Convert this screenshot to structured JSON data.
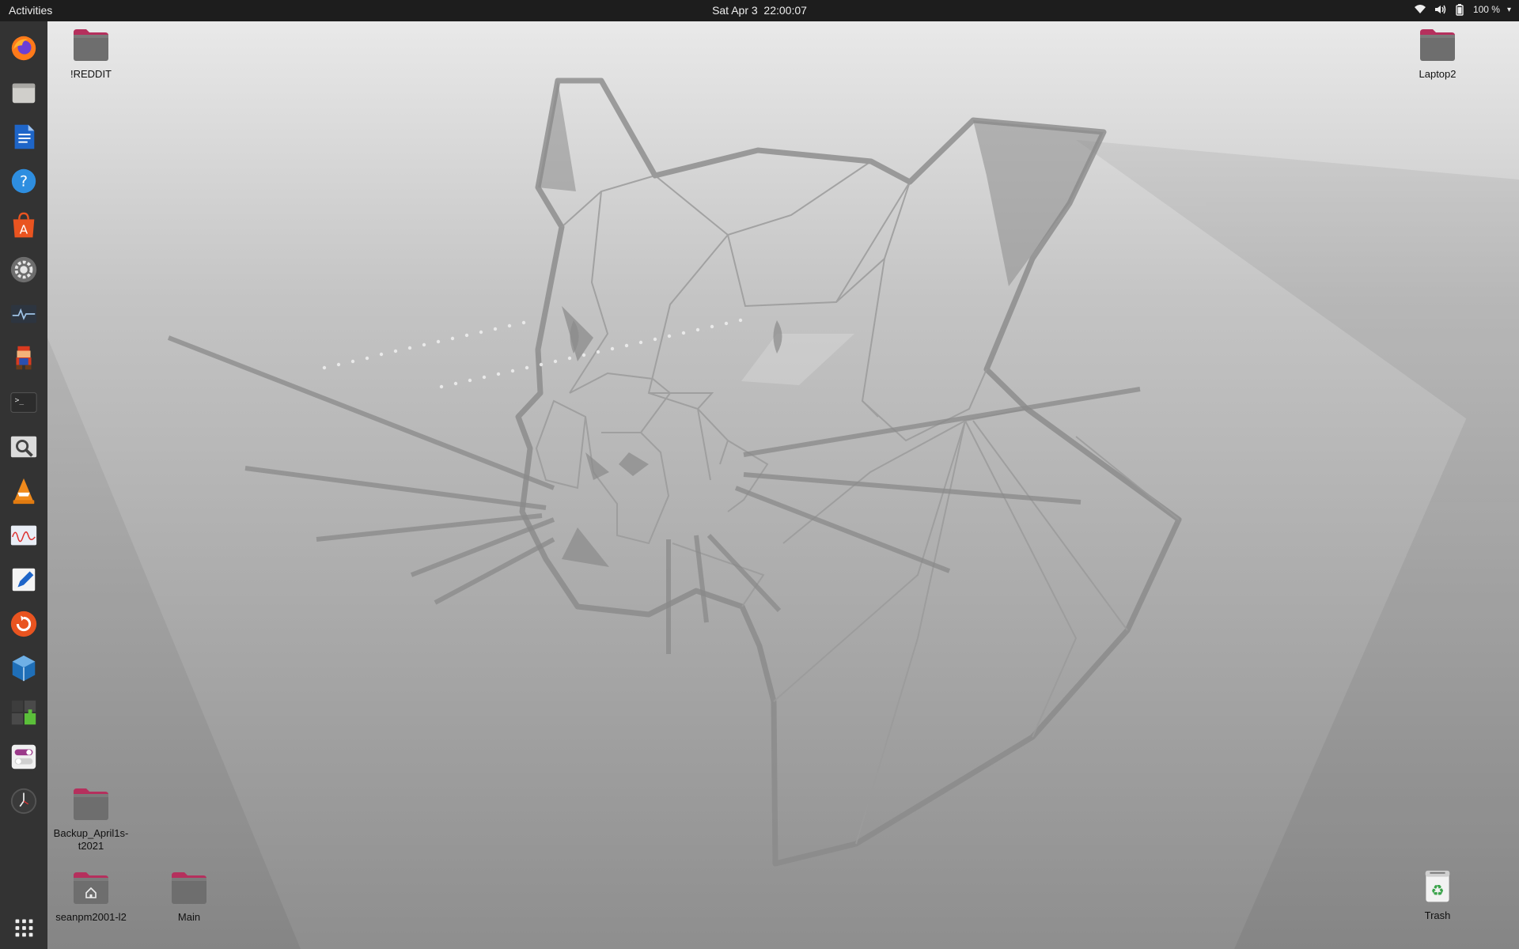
{
  "topbar": {
    "activities": "Activities",
    "datetime": "Sat Apr 3  22:00:07",
    "battery_percent": "100 %",
    "tray_icons": [
      "wifi-icon",
      "volume-icon",
      "battery-icon",
      "chevron-down-icon"
    ]
  },
  "dock": {
    "apps": [
      {
        "name": "firefox",
        "icon": "firefox-icon"
      },
      {
        "name": "files",
        "icon": "files-icon"
      },
      {
        "name": "libreoffice-writer",
        "icon": "writer-icon"
      },
      {
        "name": "help",
        "icon": "help-icon"
      },
      {
        "name": "software-center",
        "icon": "software-icon"
      },
      {
        "name": "settings",
        "icon": "settings-icon"
      },
      {
        "name": "system-monitor",
        "icon": "system-monitor-icon"
      },
      {
        "name": "game",
        "icon": "game-icon"
      },
      {
        "name": "terminal",
        "icon": "terminal-icon"
      },
      {
        "name": "magnifier",
        "icon": "magnifier-icon"
      },
      {
        "name": "vlc",
        "icon": "vlc-icon"
      },
      {
        "name": "waveform",
        "icon": "waveform-icon"
      },
      {
        "name": "text-editor",
        "icon": "text-editor-icon"
      },
      {
        "name": "software-updater",
        "icon": "updater-icon"
      },
      {
        "name": "virtualbox",
        "icon": "virtualbox-icon"
      },
      {
        "name": "extensions",
        "icon": "extensions-icon"
      },
      {
        "name": "tweaks",
        "icon": "tweaks-icon"
      },
      {
        "name": "clock",
        "icon": "clock-icon"
      }
    ],
    "show_apps_icon": "apps-grid-icon"
  },
  "desktop": {
    "icons": [
      {
        "label": "!REDDIT",
        "type": "folder"
      },
      {
        "label": "Laptop2",
        "type": "folder"
      },
      {
        "label": "Backup_April1s-t2021",
        "type": "folder"
      },
      {
        "label": "seanpm2001-l2",
        "type": "home-folder"
      },
      {
        "label": "Main",
        "type": "folder"
      },
      {
        "label": "Trash",
        "type": "trash"
      }
    ]
  },
  "colors": {
    "topbar": "#1d1d1d",
    "dock": "#333333",
    "folder_body": "#6e6e6e",
    "folder_tab": "#b5305d"
  }
}
